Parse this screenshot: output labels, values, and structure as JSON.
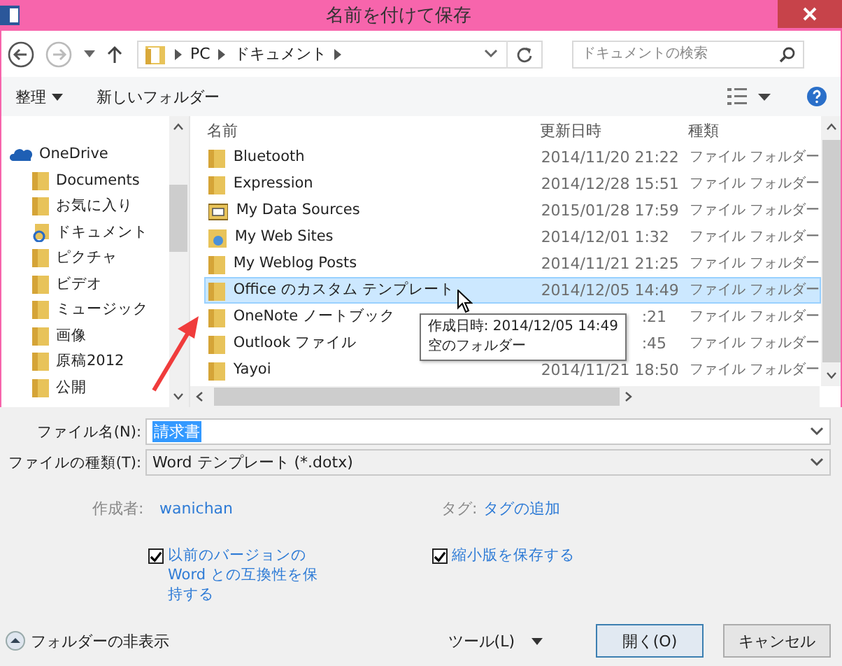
{
  "window": {
    "title": "名前を付けて保存"
  },
  "nav": {
    "path": [
      "PC",
      "ドキュメント"
    ],
    "search": {
      "placeholder": "ドキュメントの検索"
    }
  },
  "toolbar": {
    "organize": "整理",
    "new_folder": "新しいフォルダー"
  },
  "sidebar": {
    "items": [
      {
        "label": "OneDrive",
        "kind": "cloud",
        "children": [
          {
            "label": "Documents",
            "kind": "folder"
          },
          {
            "label": "お気に入り",
            "kind": "folder"
          },
          {
            "label": "ドキュメント",
            "kind": "sync"
          },
          {
            "label": "ピクチャ",
            "kind": "folder"
          },
          {
            "label": "ビデオ",
            "kind": "folder"
          },
          {
            "label": "ミュージック",
            "kind": "folder"
          },
          {
            "label": "画像",
            "kind": "folder"
          },
          {
            "label": "原稿2012",
            "kind": "folder"
          },
          {
            "label": "公開",
            "kind": "folder"
          }
        ]
      }
    ]
  },
  "table": {
    "columns": [
      "名前",
      "更新日時",
      "種類"
    ],
    "rows": [
      {
        "name": "Bluetooth",
        "date": "2014/11/20 21:22",
        "type": "ファイル フォルダー",
        "kind": "folder",
        "selected": false,
        "covered": false
      },
      {
        "name": "Expression",
        "date": "2014/12/28 15:51",
        "type": "ファイル フォルダー",
        "kind": "folder",
        "selected": false,
        "covered": false
      },
      {
        "name": "My Data Sources",
        "date": "2015/01/28 17:59",
        "type": "ファイル フォルダー",
        "kind": "data",
        "selected": false,
        "covered": false
      },
      {
        "name": "My Web Sites",
        "date": "2014/12/01 1:32",
        "type": "ファイル フォルダー",
        "kind": "web",
        "selected": false,
        "covered": false
      },
      {
        "name": "My Weblog Posts",
        "date": "2014/11/21 21:25",
        "type": "ファイル フォルダー",
        "kind": "folder",
        "selected": false,
        "covered": false
      },
      {
        "name": "Office のカスタム テンプレート",
        "date": "2014/12/05 14:49",
        "type": "ファイル フォルダー",
        "kind": "folder",
        "selected": true,
        "covered": false
      },
      {
        "name": "OneNote ノートブック",
        "date": ":21",
        "type": "ファイル フォルダー",
        "kind": "folder",
        "selected": false,
        "covered": true
      },
      {
        "name": "Outlook ファイル",
        "date": ":45",
        "type": "ファイル フォルダー",
        "kind": "folder",
        "selected": false,
        "covered": true
      },
      {
        "name": "Yayoi",
        "date": "2014/11/21 18:50",
        "type": "ファイル フォルダー",
        "kind": "folder",
        "selected": false,
        "covered": false
      }
    ]
  },
  "tooltip": {
    "lines": [
      "作成日時: 2014/12/05 14:49",
      "空のフォルダー"
    ]
  },
  "form": {
    "filename": {
      "label": "ファイル名(N):",
      "value": "請求書"
    },
    "filetype": {
      "label": "ファイルの種類(T):",
      "value": "Word テンプレート (*.dotx)"
    },
    "author": {
      "label": "作成者:",
      "value": "wanichan"
    },
    "tags": {
      "label": "タグ:",
      "value": "タグの追加"
    },
    "checkboxes": [
      {
        "label": "以前のバージョンの Word との互換性を保持する",
        "checked": true
      },
      {
        "label": "縮小版を保存する",
        "checked": true
      }
    ]
  },
  "footer": {
    "hide_folders": "フォルダーの非表示",
    "tools": "ツール(L)",
    "buttons": [
      "開く(O)",
      "キャンセル"
    ]
  }
}
